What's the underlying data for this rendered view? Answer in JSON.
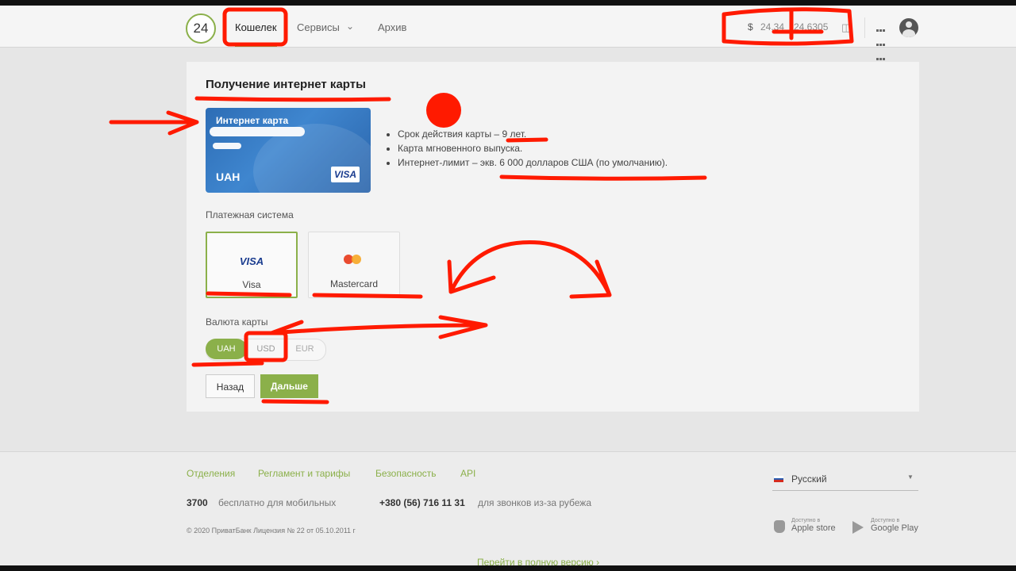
{
  "header": {
    "logo": "24",
    "nav": [
      {
        "label": "Кошелек",
        "active": true
      },
      {
        "label": "Сервисы",
        "active": false
      },
      {
        "label": "Архив",
        "active": false
      }
    ],
    "currency_symbol": "$",
    "rate_buy": "24.34",
    "rate_sell": "24.6305"
  },
  "page": {
    "title": "Получение интернет карты",
    "card": {
      "name": "Интернет карта",
      "currency": "UAH",
      "brand": "VISA"
    },
    "features": [
      "Срок действия карты – 9 лет.",
      "Карта мгновенного выпуска.",
      "Интернет-лимит – экв. 6 000 долларов США (по умолчанию)."
    ],
    "payment_system_label": "Платежная система",
    "payment_systems": [
      {
        "logo": "VISA",
        "label": "Visa",
        "selected": true
      },
      {
        "logo": "mastercard",
        "label": "Mastercard",
        "selected": false
      }
    ],
    "currency_label": "Валюта карты",
    "currencies": [
      {
        "label": "UAH",
        "selected": true
      },
      {
        "label": "USD",
        "selected": false
      },
      {
        "label": "EUR",
        "selected": false
      }
    ],
    "back_label": "Назад",
    "next_label": "Дальше"
  },
  "footer": {
    "links": [
      "Отделения",
      "Регламент и тарифы",
      "Безопасность",
      "API"
    ],
    "short_number": "3700",
    "short_number_note": "бесплатно для мобильных",
    "phone": "+380 (56) 716 11 31",
    "phone_note": "для звонков из-за рубежа",
    "copyright": "© 2020 ПриватБанк Лицензия № 22 от 05.10.2011 г",
    "language": "Русский",
    "apple_small": "Доступно в",
    "apple_label": "Apple store",
    "google_small": "Доступно в",
    "google_label": "Google Play",
    "full_version": "Перейти в полную версию"
  },
  "colors": {
    "accent": "#8bb04a",
    "markup_red": "#ff1a00",
    "card_blue": "#2f6fb8"
  }
}
